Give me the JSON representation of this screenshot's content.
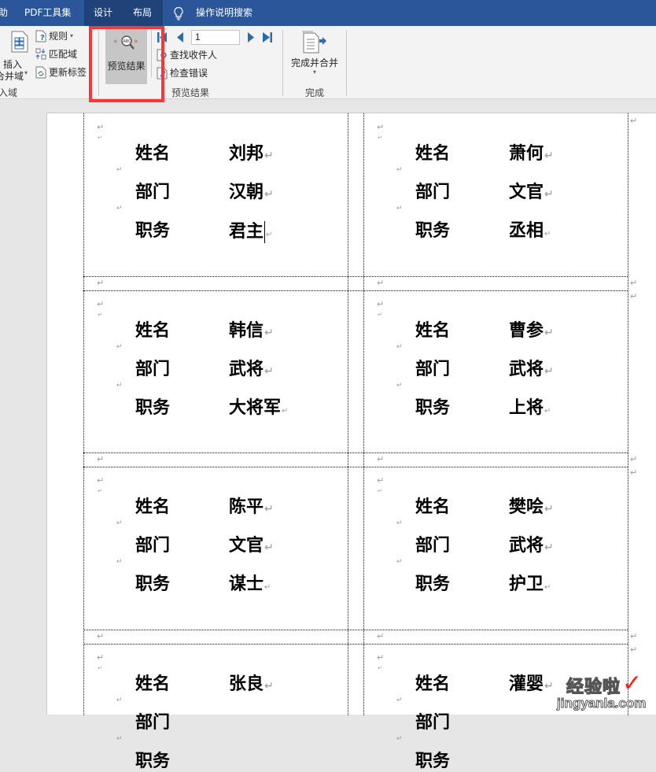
{
  "tabs": {
    "partial_left": "助",
    "pdf_tools": "PDF工具集",
    "design": "设计",
    "layout": "布局",
    "search": "操作说明搜索"
  },
  "ribbon": {
    "insert_field_group": {
      "insert_merge_field_line1": "插入",
      "insert_merge_field_line2": "合并域",
      "rules": "规则",
      "match_fields": "匹配域",
      "update_labels": "更新标签",
      "group_label": "入域"
    },
    "preview_group": {
      "preview_results_button": "预览结果",
      "record_number": "1",
      "find_recipient": "查找收件人",
      "check_errors": "检查错误",
      "group_label": "预览结果"
    },
    "finish_group": {
      "finish_merge": "完成并合并",
      "group_label": "完成"
    },
    "highlight_color": "#f23a3a"
  },
  "document": {
    "field_labels": [
      "姓名",
      "部门",
      "职务"
    ],
    "labels": [
      {
        "name": "刘邦",
        "department": "汉朝",
        "position": "君主"
      },
      {
        "name": "萧何",
        "department": "文官",
        "position": "丞相"
      },
      {
        "name": "韩信",
        "department": "武将",
        "position": "大将军"
      },
      {
        "name": "曹参",
        "department": "武将",
        "position": "上将"
      },
      {
        "name": "陈平",
        "department": "文官",
        "position": "谋士"
      },
      {
        "name": "樊哙",
        "department": "武将",
        "position": "护卫"
      },
      {
        "name": "张良",
        "department": "",
        "position": ""
      },
      {
        "name": "灌婴",
        "department": "",
        "position": ""
      }
    ],
    "paragraph_mark": "↵"
  },
  "watermark": {
    "text": "经验啦",
    "check": "✓",
    "url": "jingyanla.com"
  }
}
